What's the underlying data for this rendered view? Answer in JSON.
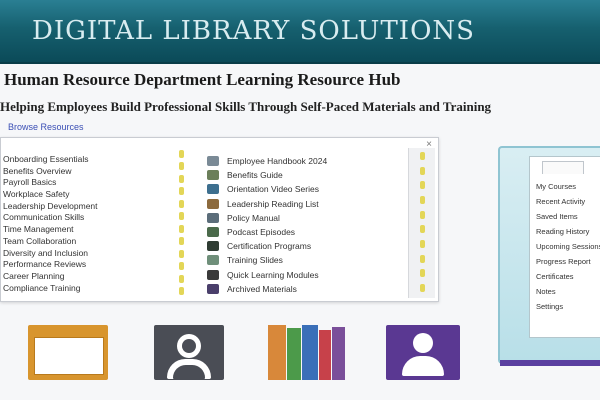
{
  "banner": {
    "title": "DIGITAL LIBRARY SOLUTIONS"
  },
  "heading": "Human Resource Department Learning Resource Hub",
  "subheading": "Helping Employees Build Professional Skills Through Self-Paced Materials and Training",
  "link": "Browse Resources",
  "app_window": {
    "close_glyph": "×",
    "left_items": [
      "Onboarding Essentials",
      "Benefits Overview",
      "Payroll Basics",
      "Workplace Safety",
      "Leadership Development",
      "Communication Skills",
      "Time Management",
      "Team Collaboration",
      "Diversity and Inclusion",
      "Performance Reviews",
      "Career Planning",
      "Compliance Training"
    ],
    "right_items": [
      {
        "icon": "document-icon",
        "color": "#7a8a96",
        "text": "Employee Handbook 2024"
      },
      {
        "icon": "document-icon",
        "color": "#6b7f5a",
        "text": "Benefits Guide"
      },
      {
        "icon": "video-icon",
        "color": "#3d6f8f",
        "text": "Orientation Video Series"
      },
      {
        "icon": "book-icon",
        "color": "#8c6a3d",
        "text": "Leadership Reading List"
      },
      {
        "icon": "document-icon",
        "color": "#5b6d7a",
        "text": "Policy Manual"
      },
      {
        "icon": "audio-icon",
        "color": "#4a6a4a",
        "text": "Podcast Episodes"
      },
      {
        "icon": "certificate-icon",
        "color": "#2f3c33",
        "text": "Certification Programs"
      },
      {
        "icon": "image-icon",
        "color": "#6f8f7a",
        "text": "Training Slides"
      },
      {
        "icon": "timer-icon",
        "color": "#3a3a3a",
        "text": "Quick Learning Modules"
      },
      {
        "icon": "folder-icon",
        "color": "#4a3f6b",
        "text": "Archived Materials"
      }
    ]
  },
  "tablet": {
    "lines": [
      "My Courses",
      "Recent Activity",
      "Saved Items",
      "Reading History",
      "Upcoming Sessions",
      "Progress Report",
      "Certificates",
      "Notes",
      "Settings"
    ]
  },
  "tiles": [
    {
      "icon": "folder-icon",
      "color": "#d8952e"
    },
    {
      "icon": "user-icon",
      "color": "#4a4d55"
    },
    {
      "icon": "books-icon",
      "color": "#7a4f9a"
    },
    {
      "icon": "contact-icon",
      "color": "#5a3892"
    }
  ]
}
